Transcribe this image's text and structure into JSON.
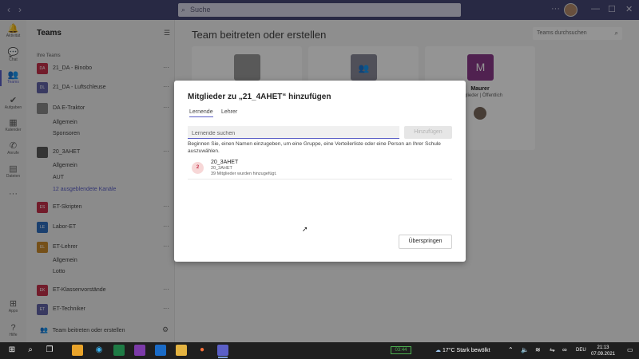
{
  "titlebar": {
    "back": "‹",
    "forward": "›",
    "search_placeholder": "Suche",
    "more": "···",
    "minimize": "—",
    "maximize": "☐",
    "close": "✕"
  },
  "rail": [
    {
      "label": "Aktivität",
      "icon": "bell-icon",
      "glyph": "🔔"
    },
    {
      "label": "Chat",
      "icon": "chat-icon",
      "glyph": "💬"
    },
    {
      "label": "Teams",
      "icon": "teams-icon",
      "glyph": "👥"
    },
    {
      "label": "Aufgaben",
      "icon": "tasks-icon",
      "glyph": "✔"
    },
    {
      "label": "Kalender",
      "icon": "calendar-icon",
      "glyph": "▦"
    },
    {
      "label": "Anrufe",
      "icon": "phone-icon",
      "glyph": "✆"
    },
    {
      "label": "Dateien",
      "icon": "files-icon",
      "glyph": "▤"
    },
    {
      "label": "",
      "icon": "more-icon",
      "glyph": "···"
    },
    {
      "label": "Apps",
      "icon": "apps-icon",
      "glyph": "⊞"
    },
    {
      "label": "Hilfe",
      "icon": "help-icon",
      "glyph": "?"
    }
  ],
  "teams_panel": {
    "title": "Teams",
    "section": "Ihre Teams",
    "teams": [
      {
        "name": "21_DA - Binobo",
        "tile": "DA",
        "color": "#c4314b"
      },
      {
        "name": "21_DA - Luftschleuse",
        "tile": "DL",
        "color": "#6264a7"
      },
      {
        "name": "DA E-Traktor",
        "tile": "",
        "color": "#8a8a8a"
      },
      {
        "name": "20_3AHET",
        "tile": "",
        "color": "#5a5a5a"
      },
      {
        "name": "ET-Skripten",
        "tile": "ES",
        "color": "#c4314b"
      },
      {
        "name": "Labor-ET",
        "tile": "LE",
        "color": "#2f6fbf"
      },
      {
        "name": "ET-Lehrer",
        "tile": "EL",
        "color": "#ca8a2c"
      },
      {
        "name": "ET-Klassenvorstände",
        "tile": "EK",
        "color": "#c4314b"
      },
      {
        "name": "ET-Techniker",
        "tile": "ET",
        "color": "#6264a7"
      }
    ],
    "channels": {
      "traktor": [
        "Allgemein",
        "Sponsoren"
      ],
      "ahet": [
        "Allgemein",
        "AUT",
        "12 ausgeblendete Kanäle"
      ],
      "lehrer": [
        "Allgemein",
        "Lotto"
      ]
    },
    "join_label": "Team beitreten oder erstellen"
  },
  "main": {
    "title": "Team beitreten oder erstellen",
    "search_placeholder": "Teams durchsuchen",
    "cards": [
      {
        "name": "",
        "sub": "",
        "logo": "",
        "color": "#9a9a9a"
      },
      {
        "name": "",
        "sub": "",
        "logo": "",
        "color": "#8a8a9a"
      },
      {
        "name": "Maurer",
        "sub": "Mitglieder | Öffentlich",
        "logo": "M",
        "color": "#8a3a8a"
      }
    ]
  },
  "dialog": {
    "title": "Mitglieder zu „21_4AHET“ hinzufügen",
    "tabs": [
      "Lernende",
      "Lehrer"
    ],
    "input_placeholder": "Lernende suchen",
    "add_label": "Hinzufügen",
    "hint": "Beginnen Sie, einen Namen einzugeben, um eine Gruppe, eine Verteilerliste oder eine Person an Ihrer Schule auszuwählen.",
    "result": {
      "badge": "2",
      "name": "20_3AHET",
      "sub": "20_3AHET",
      "message": "39 Mitglieder wurden hinzugefügt."
    },
    "skip_label": "Überspringen"
  },
  "taskbar": {
    "battery": "03:44",
    "weather": "17°C  Stark bewölkt",
    "lang": "DEU",
    "time": "21:13",
    "date": "07.09.2021"
  }
}
